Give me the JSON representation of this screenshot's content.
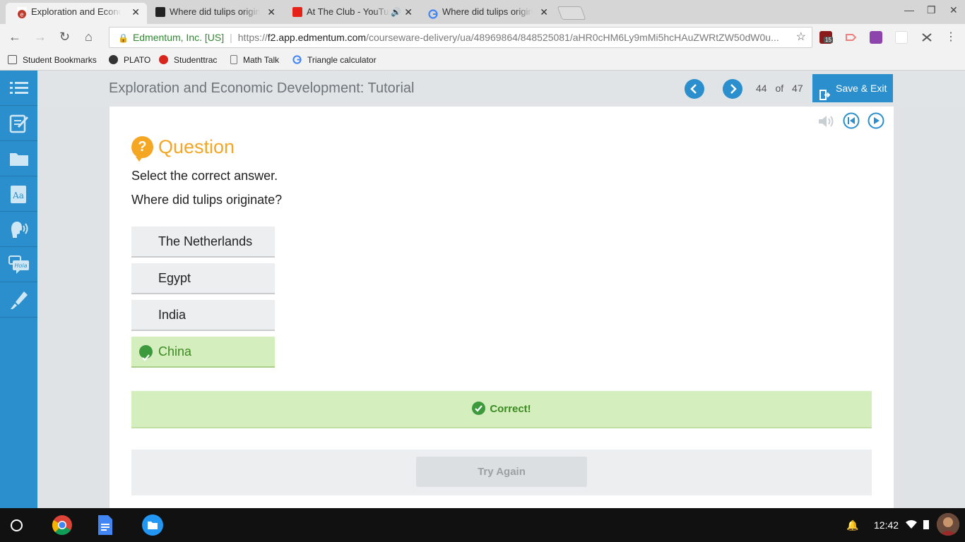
{
  "browser": {
    "tabs": [
      {
        "label": "Exploration and Econom",
        "favicon": "edmentum-icon",
        "active": true
      },
      {
        "label": "Where did tulips originat",
        "favicon": "brainly-icon",
        "active": false
      },
      {
        "label": "At The Club - YouTub",
        "favicon": "youtube-icon",
        "active": false,
        "audio": true
      },
      {
        "label": "Where did tulips originat",
        "favicon": "google-icon",
        "active": false
      }
    ],
    "address": {
      "site_name": "Edmentum, Inc. [US]",
      "scheme": "https://",
      "host": "f2.app.edmentum.com",
      "path": "/courseware-delivery/ua/48969864/848525081/aHR0cHM6Ly9mMi5hcHAuZWRtZW50dW0u..."
    },
    "extension_badge": "15",
    "bookmarks": [
      {
        "label": "Student Bookmarks",
        "icon": "folder-icon"
      },
      {
        "label": "PLATO",
        "icon": "edmentum-icon"
      },
      {
        "label": "Studenttrac",
        "icon": "apple-icon"
      },
      {
        "label": "Math Talk",
        "icon": "page-icon"
      },
      {
        "label": "Triangle calculator",
        "icon": "google-icon"
      }
    ]
  },
  "app": {
    "course_title": "Exploration and Economic Development: Tutorial",
    "page_current": "44",
    "page_of": "of",
    "page_total": "47",
    "save_exit_label": "Save & Exit",
    "sidebar_icons": [
      "list-icon",
      "notes-icon",
      "folder-icon",
      "dictionary-icon",
      "speech-icon",
      "translate-icon",
      "highlighter-icon"
    ],
    "translate_icon_text": "Hola",
    "question": {
      "heading": "Question",
      "instruction": "Select the correct answer.",
      "prompt": "Where did tulips originate?",
      "options": [
        {
          "label": "The Netherlands",
          "state": "default"
        },
        {
          "label": "Egypt",
          "state": "default"
        },
        {
          "label": "India",
          "state": "default"
        },
        {
          "label": "China",
          "state": "correct"
        }
      ],
      "feedback": "Correct!",
      "try_again_label": "Try Again"
    },
    "colors": {
      "primary": "#2a8fcc",
      "accent": "#f5a623",
      "correct": "#3c8a22",
      "correct_bg": "#d4eebd"
    }
  },
  "shelf": {
    "time": "12:42",
    "apps": [
      "chrome-icon",
      "docs-icon",
      "files-icon"
    ]
  }
}
